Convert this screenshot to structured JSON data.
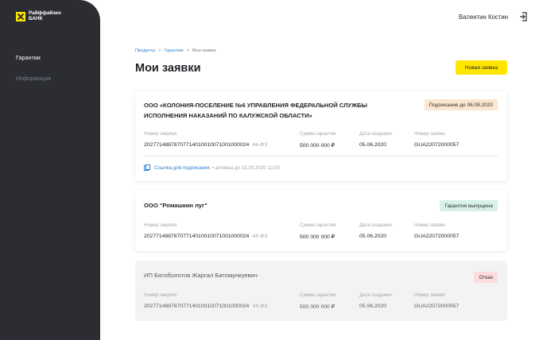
{
  "sidebar": {
    "logo_line1": "Райффайзен",
    "logo_line2": "БАНК",
    "items": [
      {
        "label": "Гарантии"
      },
      {
        "label": "Информация"
      }
    ]
  },
  "header": {
    "user_name": "Валентин Костин"
  },
  "breadcrumb": [
    "Продукты",
    "Гарантии",
    "Мои заявки"
  ],
  "page_title": "Мои заявки",
  "new_button_label": "Новая заявка",
  "labels": {
    "purchase_number": "Номер закупки",
    "guarantee_sum": "Сумма гарантии",
    "created_date": "Дата создания",
    "request_number": "Номер заявки"
  },
  "cards": [
    {
      "title": "ООО «КОЛОНИЯ-ПОСЕЛЕНИЕ №6 УПРАВЛЕНИЯ ФЕДЕРАЛЬНОЙ СЛУЖБЫ ИСПОЛНЕНИЯ НАКАЗАНИЙ ПО КАЛУЖСКОЙ ОБЛАСТИ»",
      "status": "Подписание до 06.09.2020",
      "purchase_number": "20277148878707714010010071001000024",
      "law": "44-ФЗ",
      "sum": "500 000 000 ₽",
      "date": "05.06.2020",
      "request_number": "GUA22072000057",
      "link_text": "Ссылка для подписания",
      "link_note": "• активна до 15.09.2020 13:55"
    },
    {
      "title": "ООО \"Ромашкин луг\"",
      "status": "Гарантия выпущена",
      "purchase_number": "20277148878707714010010071001000024",
      "law": "44-ФЗ",
      "sum": "500 000 000 ₽",
      "date": "05.06.2020",
      "request_number": "GUA22072000057"
    },
    {
      "title": "ИП Батоболотов Жаргал Батомункуевич",
      "status": "Отказ",
      "purchase_number": "20277148878707714010010071001000024",
      "law": "44-ФЗ",
      "sum": "500 000 000 ₽",
      "date": "05.06.2020",
      "request_number": "GUA22072000057"
    }
  ],
  "colors": {
    "sidebar": "#2b2d33",
    "accent": "#fee600",
    "link": "#2a7dcc",
    "badge_pending": "#fbe6cf",
    "badge_issued": "#d8f1e6",
    "badge_rejected": "#fddcdc"
  },
  "icons": {
    "logo": "raiffeisen-logo-icon",
    "logout": "logout-icon",
    "document": "document-icon"
  }
}
